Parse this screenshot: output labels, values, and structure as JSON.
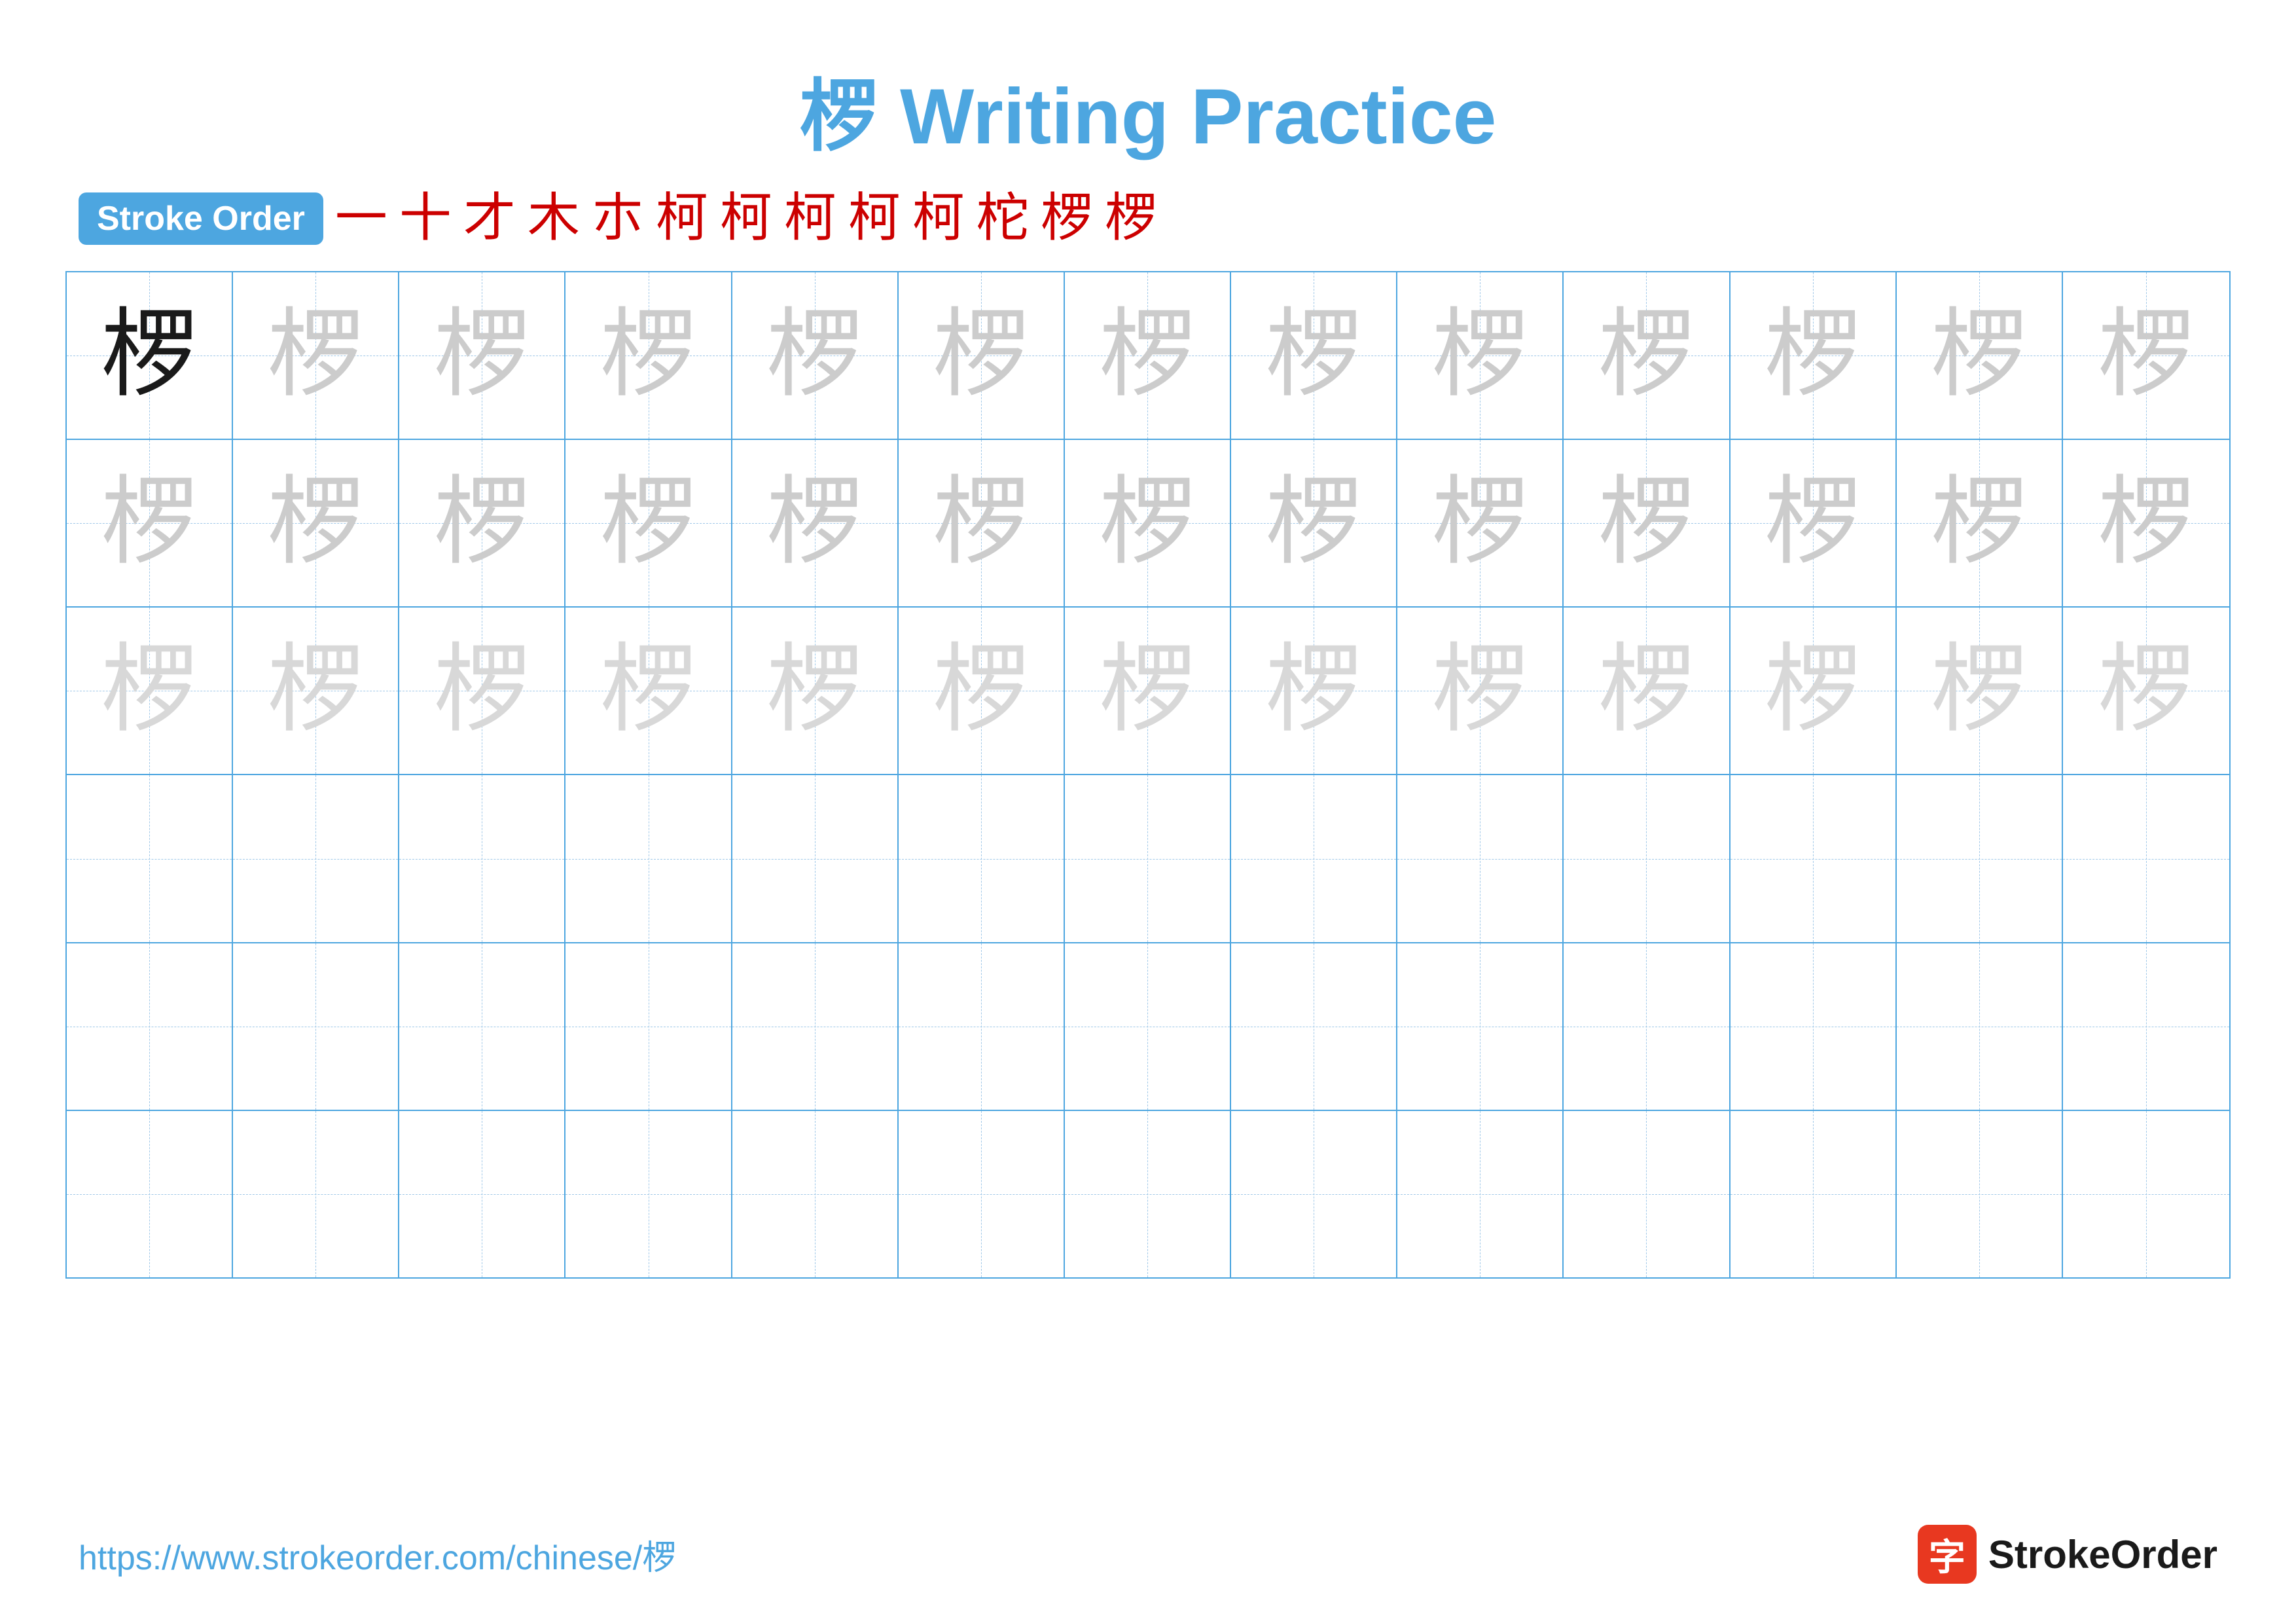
{
  "title": {
    "text": "椤 Writing Practice",
    "color": "#4da6e0"
  },
  "stroke_order": {
    "badge_label": "Stroke Order",
    "strokes": [
      "一",
      "十",
      "才",
      "木",
      "朩",
      "柯",
      "柯",
      "柯",
      "柯",
      "柯",
      "柁",
      "椤",
      "椤"
    ]
  },
  "character": "椤",
  "grid": {
    "rows": 6,
    "cols": 13
  },
  "footer": {
    "url": "https://www.strokeorder.com/chinese/椤",
    "logo_char": "字",
    "logo_text": "StrokeOrder"
  }
}
